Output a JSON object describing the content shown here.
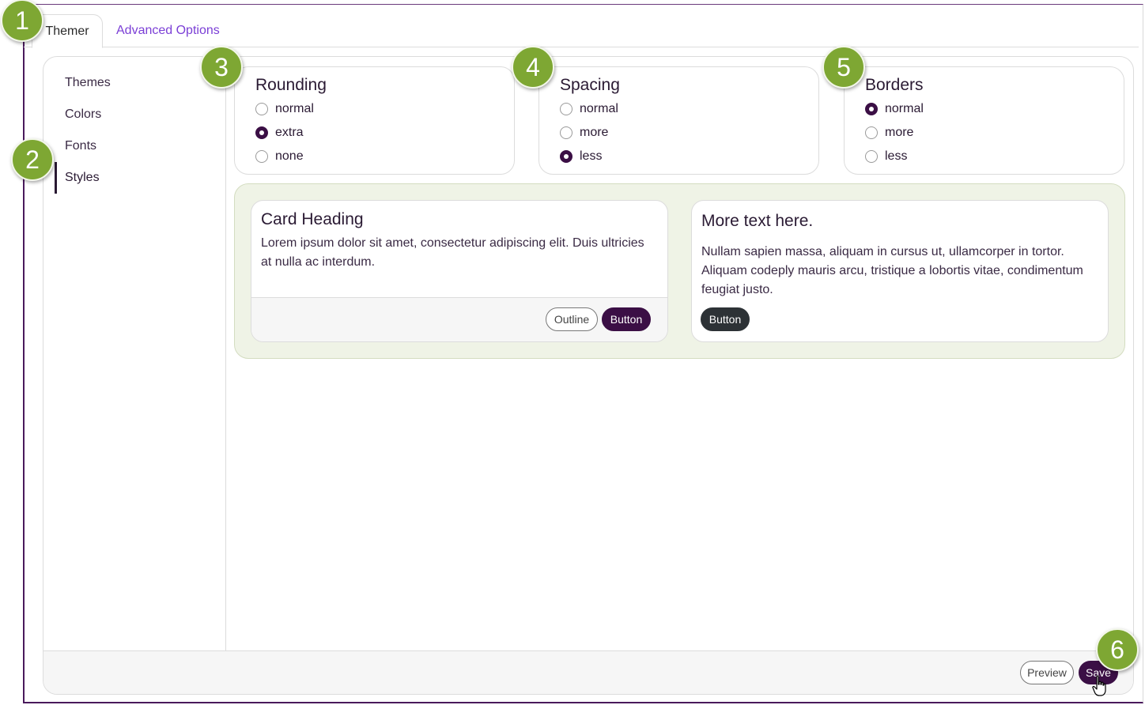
{
  "tabs": [
    {
      "label": "Themer"
    },
    {
      "label": "Advanced Options"
    }
  ],
  "sidebar": {
    "items": [
      {
        "label": "Themes"
      },
      {
        "label": "Colors"
      },
      {
        "label": "Fonts"
      },
      {
        "label": "Styles"
      }
    ]
  },
  "rounding": {
    "title": "Rounding",
    "options": [
      {
        "label": "normal",
        "checked": false
      },
      {
        "label": "extra",
        "checked": true
      },
      {
        "label": "none",
        "checked": false
      }
    ]
  },
  "spacing": {
    "title": "Spacing",
    "options": [
      {
        "label": "normal",
        "checked": false
      },
      {
        "label": "more",
        "checked": false
      },
      {
        "label": "less",
        "checked": true
      }
    ]
  },
  "borders": {
    "title": "Borders",
    "options": [
      {
        "label": "normal",
        "checked": true
      },
      {
        "label": "more",
        "checked": false
      },
      {
        "label": "less",
        "checked": false
      }
    ]
  },
  "preview": {
    "card1": {
      "heading": "Card Heading",
      "body": "Lorem ipsum dolor sit amet, consectetur adipiscing elit. Duis ultricies at nulla ac interdum.",
      "outline_label": "Outline",
      "button_label": "Button"
    },
    "card2": {
      "heading": "More text here.",
      "body": "Nullam sapien massa, aliquam in cursus ut, ullamcorper in tortor. Aliquam codeply mauris arcu, tristique a lobortis vitae, condimentum feugiat justo.",
      "button_label": "Button"
    }
  },
  "footer": {
    "preview_label": "Preview",
    "save_label": "Save"
  },
  "badges": [
    "1",
    "2",
    "3",
    "4",
    "5",
    "6"
  ],
  "colors": {
    "primary": "#3b0f45",
    "dark_button": "#2d3236",
    "link": "#7b3fd6",
    "preview_bg": "#eff3e6",
    "badge": "#7ea733"
  }
}
